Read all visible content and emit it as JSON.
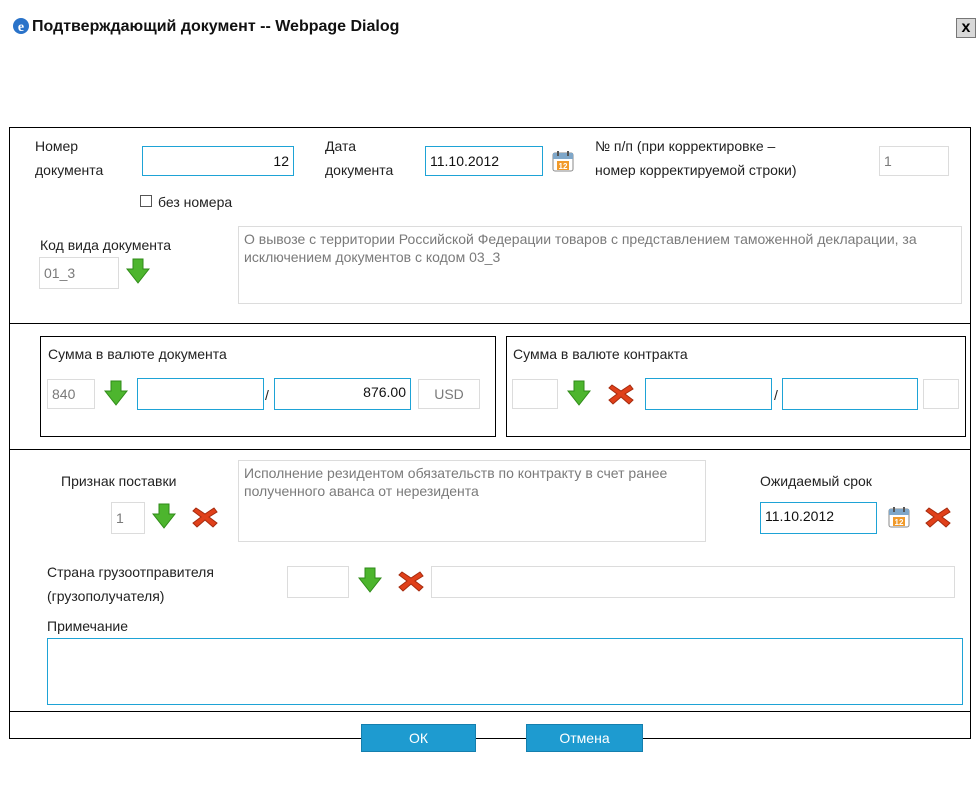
{
  "window": {
    "title": "Подтверждающий документ -- Webpage Dialog",
    "close_label": "x"
  },
  "doc": {
    "number_label_1": "Номер",
    "number_label_2": "документа",
    "number_value": "12",
    "date_label_1": "Дата",
    "date_label_2": "документа",
    "date_value": "11.10.2012",
    "np_label_1": "№ п/п (при корректировке –",
    "np_label_2": "номер корректируемой строки)",
    "np_value": "1",
    "no_number_label": "без номера",
    "no_number_checked": false,
    "kind_label": "Код вида документа",
    "kind_code": "01_3",
    "kind_description": "О вывозе с территории Российской Федерации товаров с представлением таможенной декларации, за исключением документов с кодом 03_3"
  },
  "sum_doc": {
    "title": "Сумма в валюте документа",
    "currency_code": "840",
    "value_1": "",
    "separator": "/",
    "value_2": "876.00",
    "currency_name": "USD"
  },
  "sum_contract": {
    "title": "Сумма в валюте контракта",
    "currency_code": "",
    "value_1": "",
    "separator": "/",
    "value_2": "",
    "currency_name": ""
  },
  "delivery": {
    "label": "Признак поставки",
    "code": "1",
    "description": "Исполнение резидентом обязательств по контракту в счет ранее полученного аванса от нерезидента",
    "expected_label": "Ожидаемый срок",
    "expected_date": "11.10.2012",
    "country_label_1": "Страна грузоотправителя",
    "country_label_2": "(грузополучателя)",
    "country_code": "",
    "country_name": "",
    "note_label": "Примечание",
    "note_value": ""
  },
  "buttons": {
    "ok": "ОК",
    "cancel": "Отмена"
  },
  "colors": {
    "accent": "#1e9bd0",
    "input_border": "#1ea3d6",
    "arrow_green": "#4db52e",
    "clear_red": "#e0401a"
  },
  "icons": [
    "ie-icon",
    "calendar-icon",
    "arrow-down-icon",
    "clear-x-icon"
  ]
}
